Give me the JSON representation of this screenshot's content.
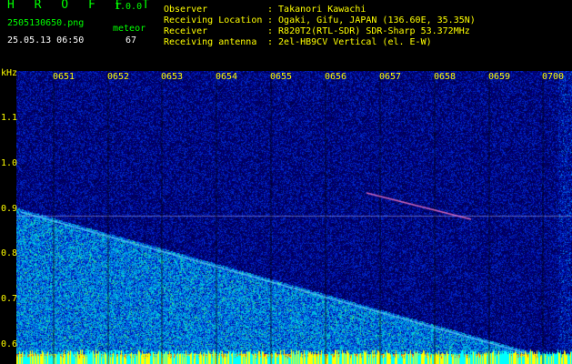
{
  "header": {
    "logo": "H R O F F T",
    "version": "1.0.0",
    "filename": "2505130650.png",
    "datetime": "25.05.13 06:50",
    "meteor_label": "meteor",
    "meteor_count": "67",
    "info": [
      {
        "label": "Observer",
        "value": ": Takanori Kawachi"
      },
      {
        "label": "Receiving Location",
        "value": ": Ogaki, Gifu, JAPAN (136.60E, 35.35N)"
      },
      {
        "label": "Receiver",
        "value": ": R820T2(RTL-SDR) SDR-Sharp 53.372MHz"
      },
      {
        "label": "Receiving antenna",
        "value": ": 2el-HB9CV Vertical (el. E-W)"
      }
    ]
  },
  "axes": {
    "y_unit": "kHz",
    "y_ticks": [
      "1.1",
      "1.0",
      "0.9",
      "0.8",
      "0.7",
      "0.6"
    ],
    "x_ticks": [
      "0651",
      "0652",
      "0653",
      "0654",
      "0655",
      "0656",
      "0657",
      "0658",
      "0659",
      "0700"
    ]
  },
  "colors": {
    "background": "#000000",
    "spectrogram_base": "#00006e",
    "header_green": "#00ff00",
    "label_yellow": "#ffff00",
    "label_white": "#ffffff"
  }
}
